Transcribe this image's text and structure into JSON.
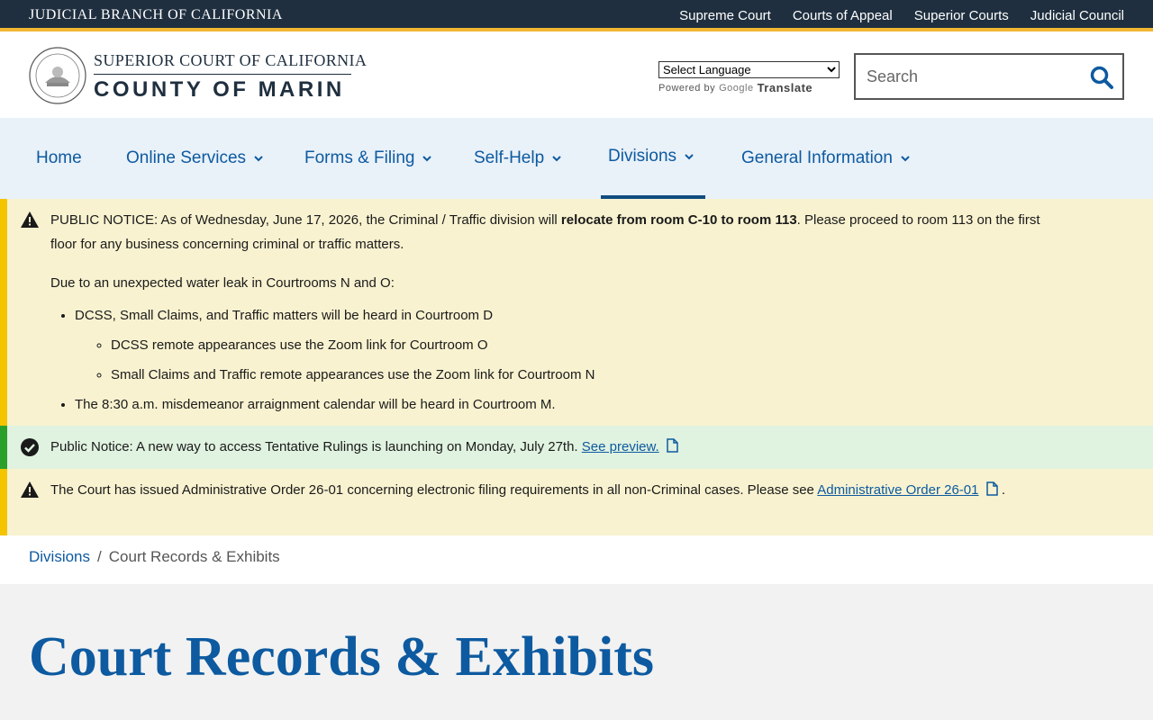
{
  "utility": {
    "brand": "JUDICIAL BRANCH OF CALIFORNIA",
    "links": [
      "Supreme Court",
      "Courts of Appeal",
      "Superior Courts",
      "Judicial Council"
    ]
  },
  "header": {
    "logo_line1": "SUPERIOR COURT OF CALIFORNIA",
    "logo_line2": "COUNTY OF MARIN",
    "translate_selected": "Select Language",
    "powered_by": "Powered by",
    "google": "Google",
    "translate": "Translate",
    "search_placeholder": "Search"
  },
  "nav": {
    "items": [
      {
        "label": "Home"
      },
      {
        "label": "Online Services"
      },
      {
        "label": "Forms & Filing"
      },
      {
        "label": "Self-Help"
      },
      {
        "label": "Divisions"
      },
      {
        "label": "General Information"
      }
    ]
  },
  "alerts": {
    "notice1": {
      "part1": "PUBLIC NOTICE: As of Wednesday, June 17, 2026, the Criminal / Traffic division will ",
      "bold": "relocate from room C-10 to room 113",
      "part2": ".  Please proceed to room 113 on the first floor for any business concerning criminal or traffic matters.",
      "leak_intro": "Due to an unexpected water leak in Courtrooms N and O:",
      "bullet1": "DCSS, Small Claims, and Traffic matters will be heard in Courtroom D",
      "sub1": "DCSS remote appearances use the Zoom link for Courtroom O",
      "sub2": "Small Claims and Traffic remote appearances use the Zoom link for Courtroom N",
      "bullet2": "The 8:30 a.m. misdemeanor arraignment calendar will be heard in Courtroom M."
    },
    "notice2": {
      "text": "Public Notice: A new way to access Tentative Rulings is launching on Monday, July 27th. ",
      "link": "See preview."
    },
    "notice3": {
      "text": "The Court has issued Administrative Order 26-01 concerning electronic filing requirements in all non-Criminal cases. Please see ",
      "link": "Administrative Order 26-01",
      "end": " ."
    }
  },
  "breadcrumb": {
    "parent": "Divisions",
    "separator": "/",
    "current": "Court Records & Exhibits"
  },
  "page": {
    "title": "Court Records & Exhibits"
  },
  "colors": {
    "utility_bg": "#1f2f3f",
    "accent_gold": "#f2b632",
    "link_blue": "#0d5aa0",
    "warn_bg": "#f8f2d0",
    "ok_bg": "#e0f2e0"
  }
}
